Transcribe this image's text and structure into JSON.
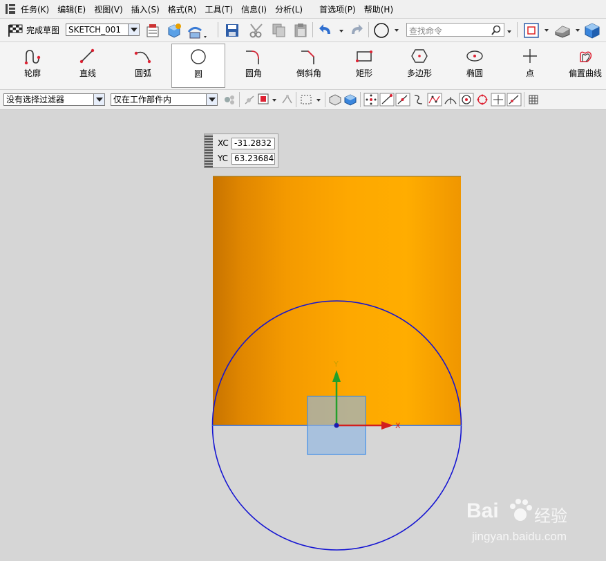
{
  "menu": {
    "items": [
      "任务(K)",
      "编辑(E)",
      "视图(V)",
      "插入(S)",
      "格式(R)",
      "工具(T)",
      "信息(I)",
      "分析(L)",
      "首选项(P)",
      "帮助(H)"
    ]
  },
  "toolbar": {
    "finish_sketch_label": "完成草图",
    "sketch_name": "SKETCH_001",
    "search_placeholder": "查找命令"
  },
  "ribbon": {
    "items": [
      {
        "label": "轮廓",
        "icon": "profile-icon"
      },
      {
        "label": "直线",
        "icon": "line-icon"
      },
      {
        "label": "圆弧",
        "icon": "arc-icon"
      },
      {
        "label": "圆",
        "icon": "circle-icon"
      },
      {
        "label": "圆角",
        "icon": "fillet-icon"
      },
      {
        "label": "倒斜角",
        "icon": "chamfer-icon"
      },
      {
        "label": "矩形",
        "icon": "rectangle-icon"
      },
      {
        "label": "多边形",
        "icon": "polygon-icon"
      },
      {
        "label": "椭圆",
        "icon": "ellipse-icon"
      },
      {
        "label": "点",
        "icon": "point-icon"
      },
      {
        "label": "偏置曲线",
        "icon": "offset-curve-icon"
      }
    ],
    "selected": "圆"
  },
  "filter_bar": {
    "selection_filter": "没有选择过滤器",
    "scope_filter": "仅在工作部件内"
  },
  "coord_input": {
    "xc_label": "XC",
    "xc_value": "-31.2832",
    "yc_label": "YC",
    "yc_value": "63.23684"
  },
  "axes": {
    "x_label": "X",
    "y_label": "Y"
  },
  "watermark": {
    "brand": "Bai",
    "brand_suffix": "经验",
    "url": "jingyan.baidu.com"
  },
  "colors": {
    "circle": "#1414d2",
    "solid_body": "#f5a000",
    "x_axis": "#d21e1e",
    "y_axis": "#22a02a",
    "sketch_plane": "#7fa9d6"
  }
}
